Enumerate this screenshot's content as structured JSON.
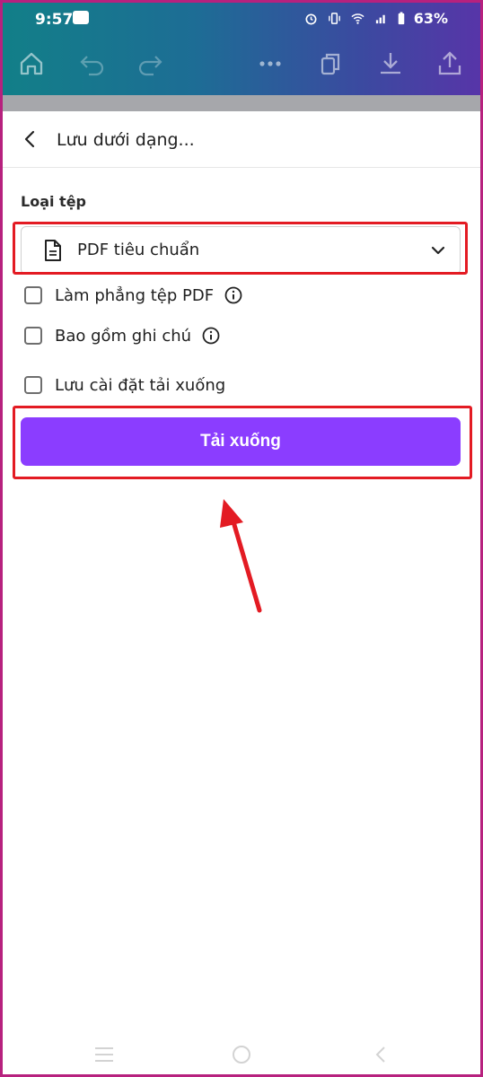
{
  "status_bar": {
    "time": "9:57",
    "battery": "63%"
  },
  "toolbar": {
    "icons": [
      "home-icon",
      "undo-icon",
      "redo-icon",
      "more-icon",
      "copy-icon",
      "download-icon",
      "share-icon"
    ]
  },
  "header": {
    "title": "Lưu dưới dạng..."
  },
  "file_type": {
    "label": "Loại tệp",
    "selected": "PDF tiêu chuẩn"
  },
  "options": [
    {
      "label": "Làm phẳng tệp PDF",
      "checked": false,
      "has_info": true
    },
    {
      "label": "Bao gồm ghi chú",
      "checked": false,
      "has_info": true
    },
    {
      "label": "Lưu cài đặt tải xuống",
      "checked": false,
      "has_info": false
    }
  ],
  "download_button": {
    "label": "Tải xuống"
  },
  "colors": {
    "accent": "#8b3dff",
    "highlight": "#e31b23",
    "frame": "#b7217e"
  }
}
